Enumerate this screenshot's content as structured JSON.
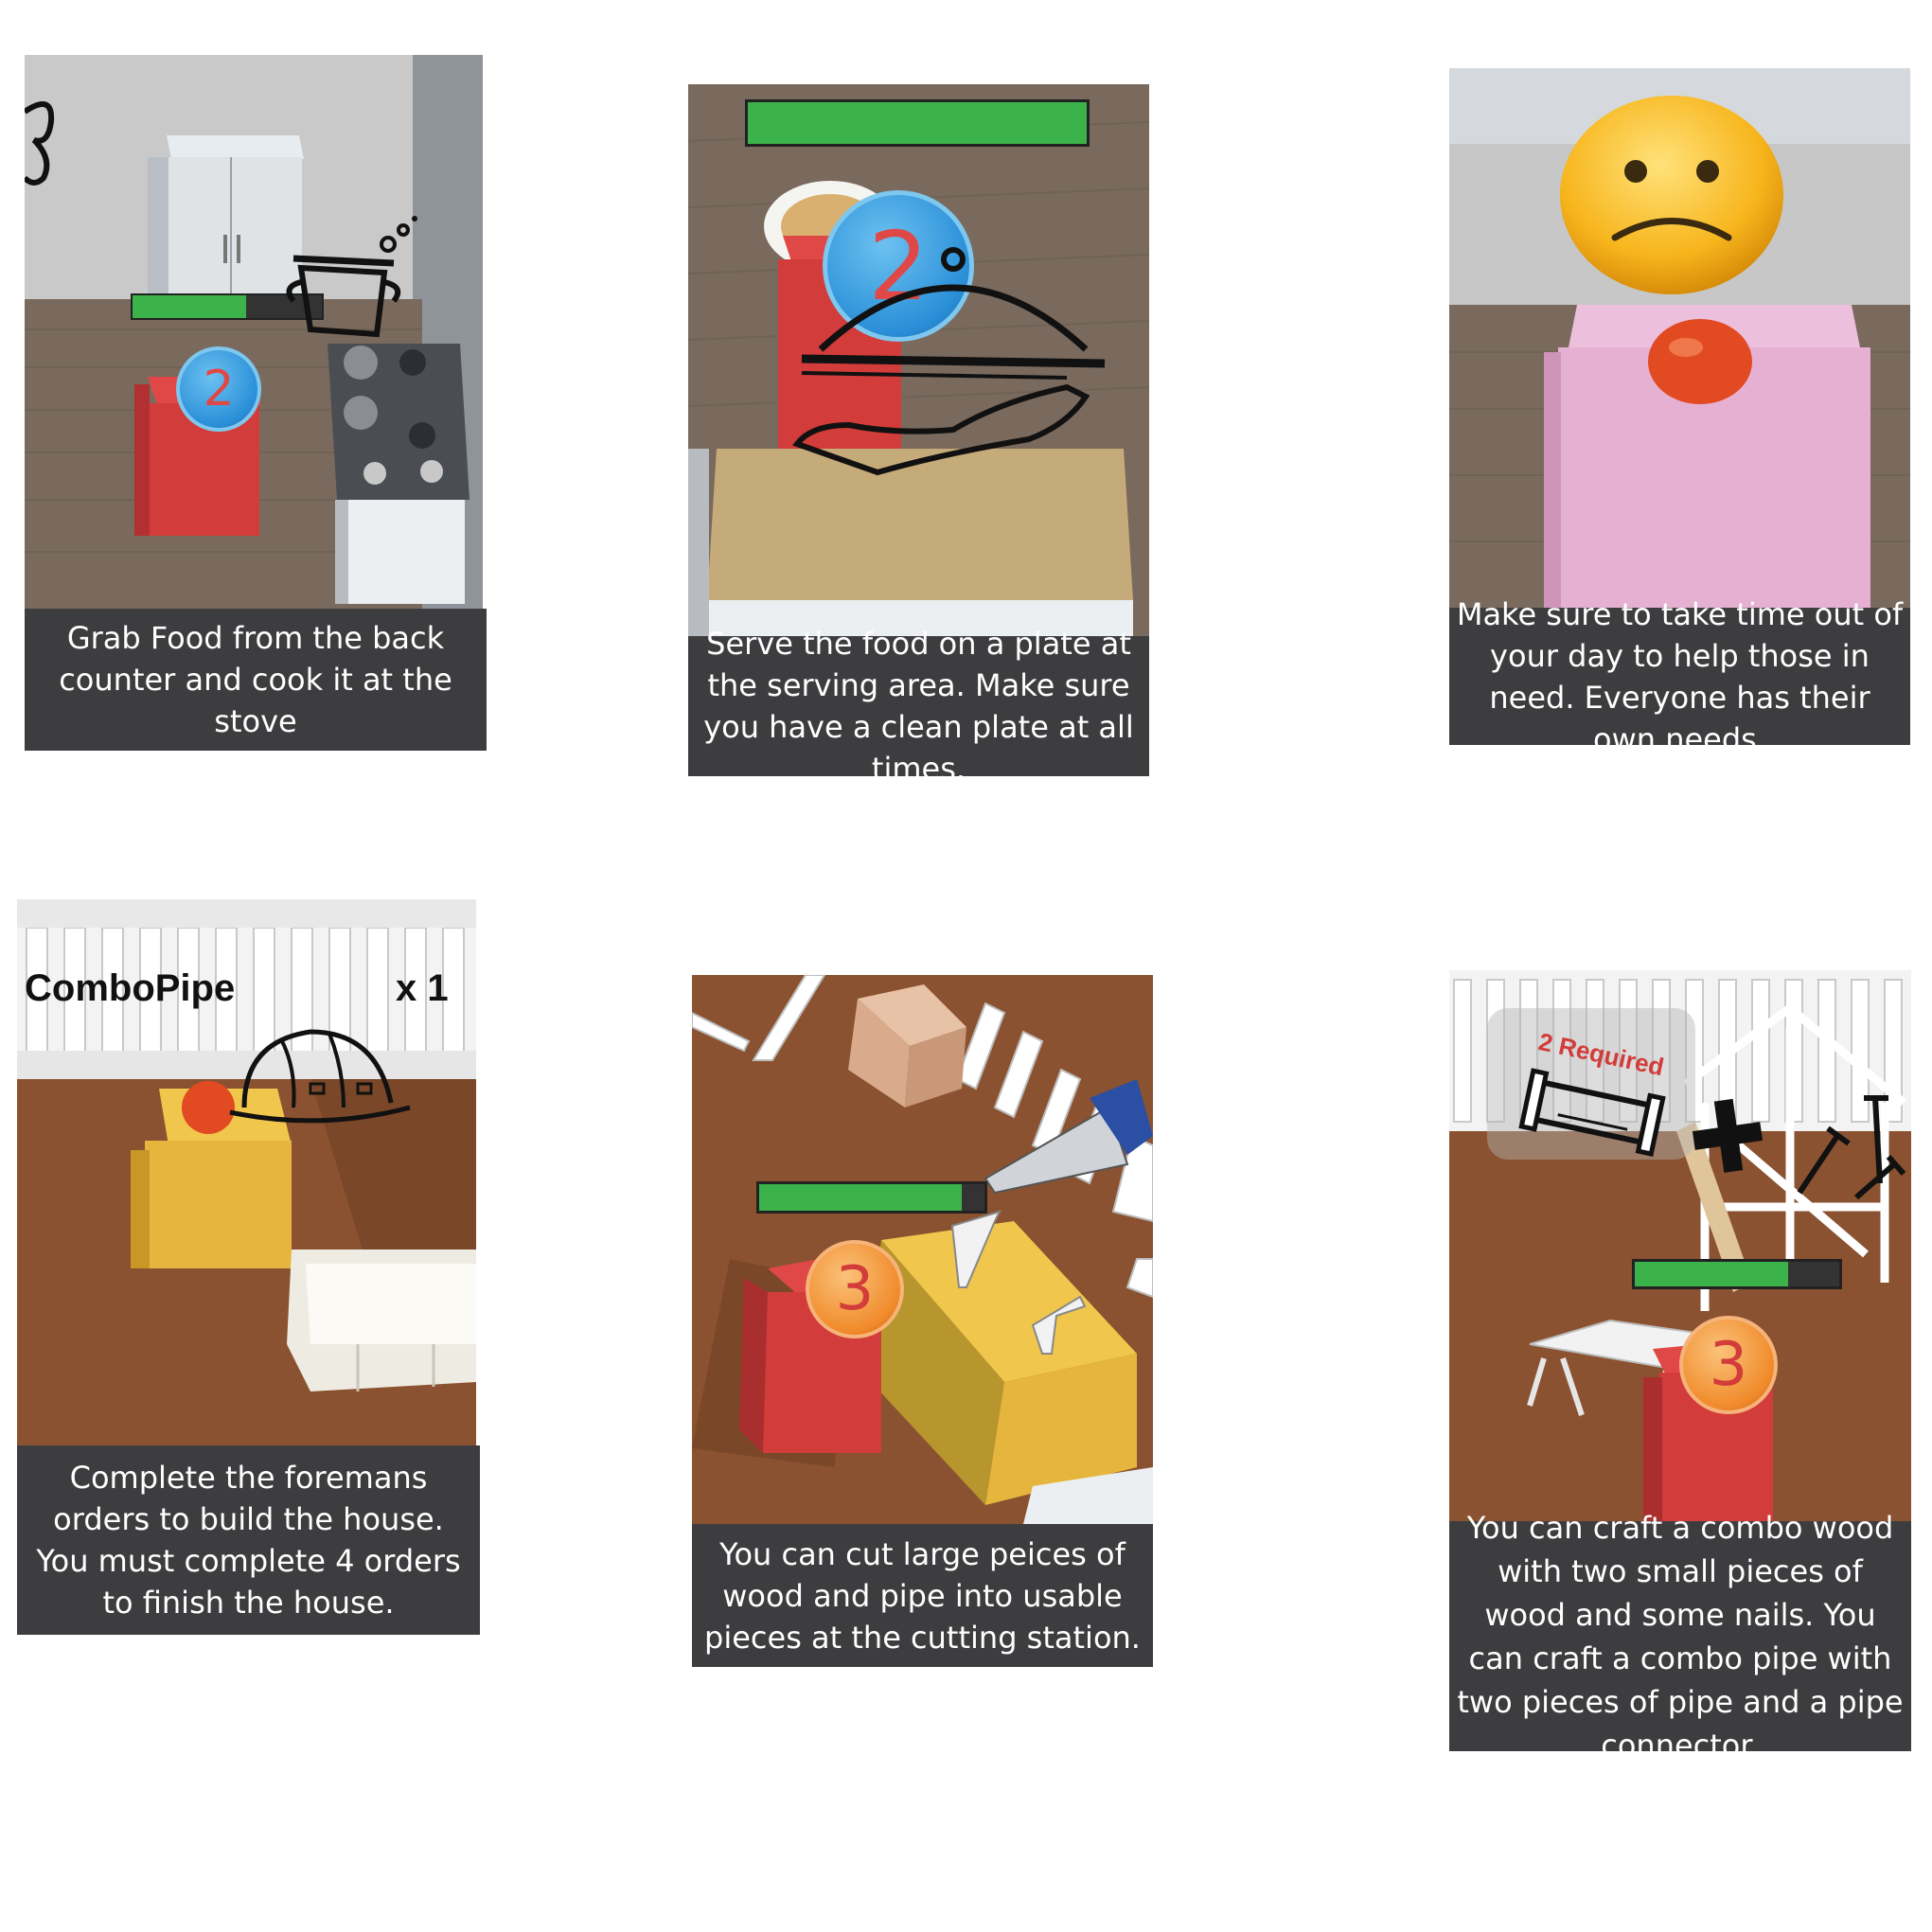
{
  "colors": {
    "caption_bg": "#3d3d3f",
    "progress_green": "#3cb34a",
    "floor_wood": "#7a6a5e",
    "floor_brown": "#8a5230",
    "counter_red": "#d23c3a",
    "counter_pink": "#e5b0d2",
    "counter_yellow": "#e6b53e",
    "badge_blue": "#2a8fd8",
    "badge_orange": "#f08a2a",
    "emoji_yellow": "#f7b51c"
  },
  "panels": [
    {
      "id": "kitchen-cook",
      "icon": "cooking-pot-icon",
      "badge": "2",
      "progress": 0.6,
      "caption": "Grab Food from the back counter and cook it at the stove"
    },
    {
      "id": "kitchen-serve",
      "icon": "serving-cloche-icon",
      "badge": "2",
      "progress": 1.0,
      "caption": "Serve the food on a plate at the serving area. Make sure you have a clean plate at all times."
    },
    {
      "id": "help-others",
      "icon": "sad-face-icon",
      "caption": "Make sure to take time out of your day to help those in need. Everyone has their own needs."
    },
    {
      "id": "foreman-orders",
      "icon": "hard-hat-icon",
      "order_item": "ComboPipe",
      "order_count": "x 1",
      "caption": "Complete the foremans orders to build the house. You must complete 4 orders to finish the house."
    },
    {
      "id": "cutting-station",
      "icon": "saw-icon",
      "badge": "3",
      "progress": 0.9,
      "caption": "You can cut large peices of wood and pipe into usable pieces at the cutting station."
    },
    {
      "id": "crafting",
      "icon": "pipe-plus-nails-icon",
      "badge": "3",
      "required_label": "2 Required",
      "progress": 0.75,
      "caption": "You can craft a combo wood with two small pieces of wood and some nails. You can craft a combo pipe with two pieces of pipe and a pipe connector."
    }
  ]
}
